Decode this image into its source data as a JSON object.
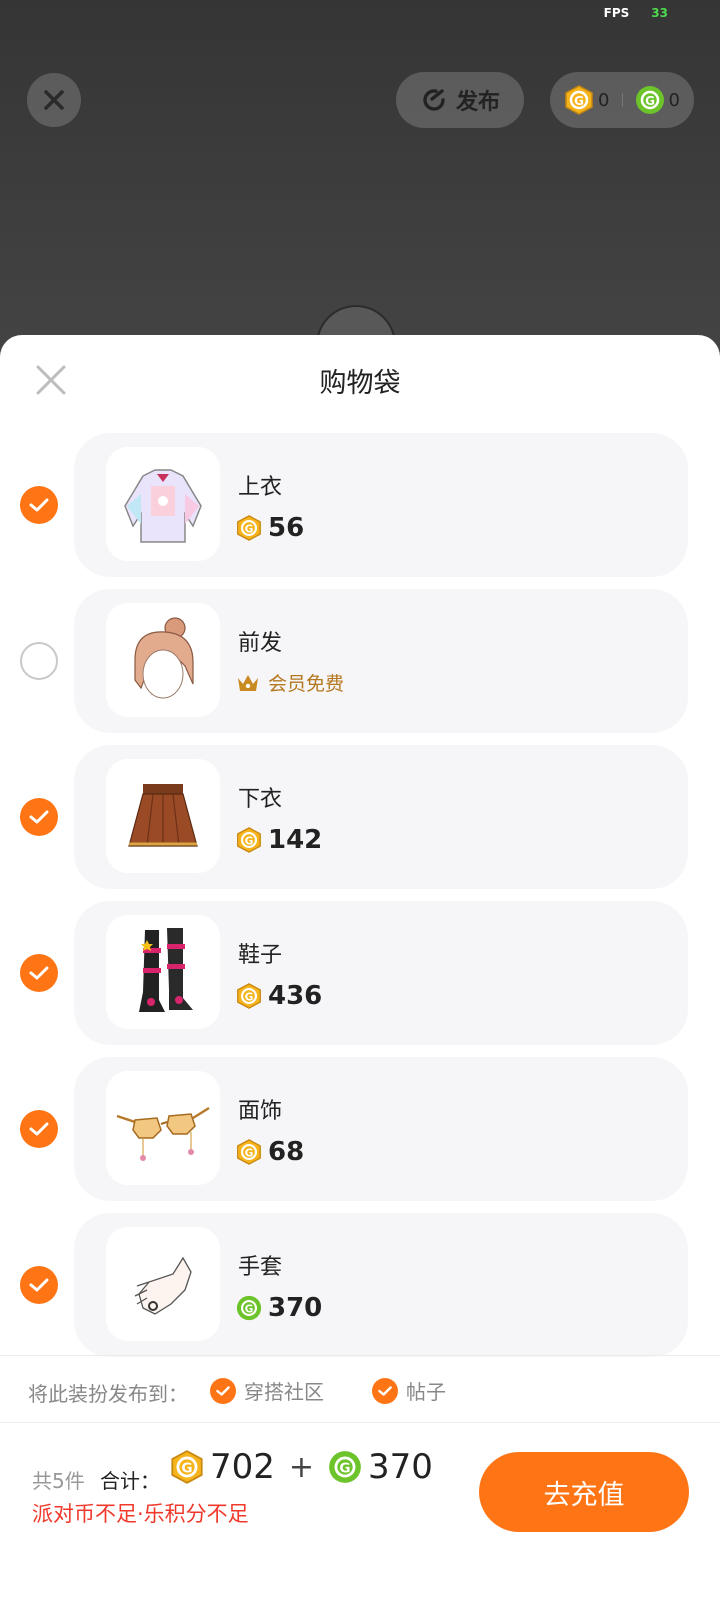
{
  "status": {
    "fps_label": "FPS",
    "fps_value": "33"
  },
  "topbar": {
    "publish_label": "发布",
    "gold_coin_count": "0",
    "green_coin_count": "0"
  },
  "sheet": {
    "title": "购物袋"
  },
  "items": [
    {
      "name": "上衣",
      "price": "56",
      "currency": "gold",
      "checked": true,
      "thumb": "jacket-thumbnail"
    },
    {
      "name": "前发",
      "price_text": "会员免费",
      "currency": "vip",
      "checked": false,
      "thumb": "hair-thumbnail"
    },
    {
      "name": "下衣",
      "price": "142",
      "currency": "gold",
      "checked": true,
      "thumb": "skirt-thumbnail"
    },
    {
      "name": "鞋子",
      "price": "436",
      "currency": "gold",
      "checked": true,
      "thumb": "boots-thumbnail"
    },
    {
      "name": "面饰",
      "price": "68",
      "currency": "gold",
      "checked": true,
      "thumb": "glasses-thumbnail"
    },
    {
      "name": "手套",
      "price": "370",
      "currency": "green",
      "checked": true,
      "thumb": "glove-thumbnail"
    }
  ],
  "publish": {
    "label": "将此装扮发布到：",
    "options": [
      {
        "label": "穿搭社区",
        "checked": true
      },
      {
        "label": "帖子",
        "checked": true
      }
    ]
  },
  "footer": {
    "count_text": "共5件",
    "total_label": "合计：",
    "gold_total": "702",
    "plus": "+",
    "green_total": "370",
    "warning": "派对币不足·乐积分不足",
    "recharge_label": "去充值"
  },
  "colors": {
    "accent": "#ff7515",
    "warning": "#f0392b",
    "gold": "#f6b41c",
    "green": "#6cc32a"
  }
}
